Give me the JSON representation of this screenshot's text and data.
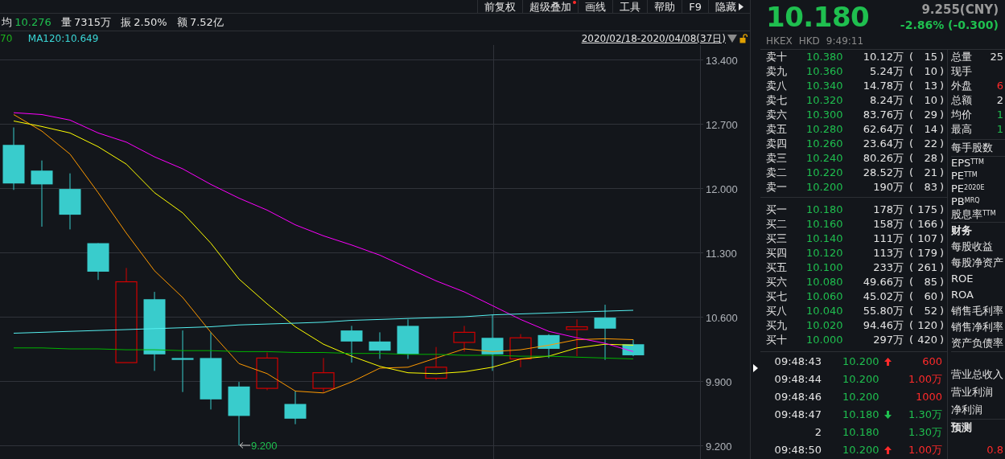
{
  "toolbar": [
    {
      "label": "前复权",
      "dot": false,
      "menu": false
    },
    {
      "label": "超级叠加",
      "dot": true,
      "menu": false
    },
    {
      "label": "画线",
      "dot": false,
      "menu": false
    },
    {
      "label": "工具",
      "dot": false,
      "menu": false
    },
    {
      "label": "帮助",
      "dot": false,
      "menu": false
    },
    {
      "label": "F9",
      "dot": false,
      "menu": false
    },
    {
      "label": "隐藏",
      "dot": false,
      "menu": true
    }
  ],
  "summary": [
    {
      "label": "均",
      "value": "10.276",
      "color": "#1fbf4f"
    },
    {
      "label": "量",
      "value": "7315万",
      "color": "#e4e4e4"
    },
    {
      "label": "振",
      "value": "2.50%",
      "color": "#e4e4e4"
    },
    {
      "label": "额",
      "value": "7.52亿",
      "color": "#e4e4e4"
    }
  ],
  "indicators": [
    {
      "text": "70",
      "color": "#1db31d"
    },
    {
      "text": "MA120:10.649",
      "color": "#3ad6d6"
    }
  ],
  "date_range": "2020/02/18-2020/04/08(37日)",
  "chart": {
    "chart_data": {
      "type": "line",
      "grid": true,
      "ylim": [
        9.051,
        13.557
      ],
      "yticks": [
        {
          "value": 13.4,
          "label": "13.400"
        },
        {
          "value": 12.7,
          "label": "12.700"
        },
        {
          "value": 12.0,
          "label": "12.000"
        },
        {
          "value": 11.3,
          "label": "11.300"
        },
        {
          "value": 10.6,
          "label": "10.600"
        },
        {
          "value": 9.9,
          "label": "9.900"
        },
        {
          "value": 9.2,
          "label": "9.200"
        }
      ],
      "series": [
        {
          "color": "#ff9900",
          "values": [
            12.8,
            12.62,
            12.37,
            11.95,
            11.51,
            11.1,
            10.81,
            10.43,
            10.09,
            9.98,
            9.79,
            9.77,
            9.89,
            10.04,
            10.05,
            10.15,
            10.25,
            10.22,
            10.24,
            10.29,
            10.35,
            10.36,
            10.35
          ]
        },
        {
          "color": "#ffff00",
          "values": [
            12.73,
            12.67,
            12.6,
            12.45,
            12.26,
            11.95,
            11.73,
            11.4,
            11.01,
            10.74,
            10.49,
            10.3,
            10.17,
            10.06,
            9.99,
            9.98,
            10.0,
            10.05,
            10.14,
            10.17,
            10.26,
            10.3,
            10.29
          ]
        },
        {
          "color": "#ff00ff",
          "values": [
            12.82,
            12.8,
            12.74,
            12.6,
            12.5,
            12.34,
            12.21,
            12.04,
            11.89,
            11.76,
            11.6,
            11.48,
            11.38,
            11.27,
            11.13,
            10.99,
            10.87,
            10.72,
            10.57,
            10.44,
            10.37,
            10.31,
            10.22
          ]
        },
        {
          "color": "#55f0f0",
          "values": [
            10.42,
            10.43,
            10.44,
            10.45,
            10.46,
            10.47,
            10.48,
            10.49,
            10.51,
            10.52,
            10.53,
            10.54,
            10.56,
            10.57,
            10.58,
            10.59,
            10.6,
            10.62,
            10.63,
            10.64,
            10.65,
            10.66,
            10.67
          ]
        },
        {
          "color": "#00b400",
          "values": [
            10.26,
            10.26,
            10.25,
            10.25,
            10.24,
            10.24,
            10.23,
            10.23,
            10.22,
            10.22,
            10.21,
            10.21,
            10.2,
            10.2,
            10.19,
            10.19,
            10.18,
            10.18,
            10.17,
            10.17,
            10.16,
            10.15,
            10.14
          ]
        }
      ],
      "annotations": [
        {
          "text": "9.200"
        }
      ]
    }
  },
  "quote": {
    "price": "10.180",
    "price_cny": "9.255(CNY)",
    "change": "-2.86% (-0.300)",
    "color": "#1fbf4f",
    "exchange": "HKEX",
    "currency": "HKD",
    "time": "9:49:11"
  },
  "asks": [
    {
      "label": "卖十",
      "price": "10.380",
      "volume": "10.12万",
      "open": "(",
      "count": "15",
      "close": ")"
    },
    {
      "label": "卖九",
      "price": "10.360",
      "volume": "5.24万",
      "open": "(",
      "count": "10",
      "close": ")"
    },
    {
      "label": "卖八",
      "price": "10.340",
      "volume": "14.78万",
      "open": "(",
      "count": "13",
      "close": ")"
    },
    {
      "label": "卖七",
      "price": "10.320",
      "volume": "8.24万",
      "open": "(",
      "count": "10",
      "close": ")"
    },
    {
      "label": "卖六",
      "price": "10.300",
      "volume": "83.76万",
      "open": "(",
      "count": "29",
      "close": ")"
    },
    {
      "label": "卖五",
      "price": "10.280",
      "volume": "62.64万",
      "open": "(",
      "count": "14",
      "close": ")"
    },
    {
      "label": "卖四",
      "price": "10.260",
      "volume": "23.64万",
      "open": "(",
      "count": "22",
      "close": ")"
    },
    {
      "label": "卖三",
      "price": "10.240",
      "volume": "80.26万",
      "open": "(",
      "count": "28",
      "close": ")"
    },
    {
      "label": "卖二",
      "price": "10.220",
      "volume": "28.52万",
      "open": "(",
      "count": "21",
      "close": ")"
    },
    {
      "label": "卖一",
      "price": "10.200",
      "volume": "190万",
      "open": "(",
      "count": "83",
      "close": ")"
    }
  ],
  "bids": [
    {
      "label": "买一",
      "price": "10.180",
      "volume": "178万",
      "open": "(",
      "count": "175",
      "close": ")"
    },
    {
      "label": "买二",
      "price": "10.160",
      "volume": "158万",
      "open": "(",
      "count": "166",
      "close": ")"
    },
    {
      "label": "买三",
      "price": "10.140",
      "volume": "111万",
      "open": "(",
      "count": "107",
      "close": ")"
    },
    {
      "label": "买四",
      "price": "10.120",
      "volume": "113万",
      "open": "(",
      "count": "179",
      "close": ")"
    },
    {
      "label": "买五",
      "price": "10.100",
      "volume": "233万",
      "open": "(",
      "count": "261",
      "close": ")"
    },
    {
      "label": "买六",
      "price": "10.080",
      "volume": "49.66万",
      "open": "(",
      "count": "85",
      "close": ")"
    },
    {
      "label": "买七",
      "price": "10.060",
      "volume": "45.02万",
      "open": "(",
      "count": "60",
      "close": ")"
    },
    {
      "label": "买八",
      "price": "10.040",
      "volume": "55.80万",
      "open": "(",
      "count": "52",
      "close": ")"
    },
    {
      "label": "买九",
      "price": "10.020",
      "volume": "94.46万",
      "open": "(",
      "count": "120",
      "close": ")"
    },
    {
      "label": "买十",
      "price": "10.000",
      "volume": "297万",
      "open": "(",
      "count": "420",
      "close": ")"
    }
  ],
  "trades": [
    {
      "time": "09:48:43",
      "price": "10.200",
      "kind": "up",
      "volume": "600",
      "color": "#ff2a2a"
    },
    {
      "time": "09:48:44",
      "price": "10.200",
      "kind": "plain",
      "volume": "1.00万",
      "color": "#ff2a2a"
    },
    {
      "time": "09:48:46",
      "price": "10.200",
      "kind": "plain",
      "volume": "1000",
      "color": "#ff2a2a"
    },
    {
      "time": "09:48:47",
      "price": "10.180",
      "kind": "down",
      "volume": "1.30万",
      "color": "#1fbf4f"
    },
    {
      "time": "2",
      "price": "10.180",
      "kind": "plain",
      "volume": "1.30万",
      "color": "#1fbf4f"
    },
    {
      "time": "09:48:50",
      "price": "10.200",
      "kind": "up",
      "volume": "1.00万",
      "color": "#ff2a2a"
    }
  ],
  "stats": [
    {
      "label": "总量",
      "value": "25",
      "color": "#e4e4e4"
    },
    {
      "label": "现手"
    },
    {
      "label": "外盘",
      "value": "6",
      "color": "#ff2a2a"
    },
    {
      "label": "总额",
      "value": "2",
      "color": "#e4e4e4"
    },
    {
      "label": "均价",
      "value": "1",
      "color": "#1fbf4f"
    },
    {
      "label": "最高",
      "value": "1",
      "color": "#1fbf4f"
    }
  ],
  "lot_size": "每手股数",
  "valuation": [
    "EPS$^{TTM}$",
    "PE$^{TTM}$",
    "PE$^{2020E}$",
    "PB$^{MRQ}$",
    "股息率$^{TTM}$"
  ],
  "finance": {
    "title": "财务",
    "items": [
      "每股收益",
      "每股净资产",
      "ROE",
      "ROA",
      "销售毛利率",
      "销售净利率",
      "资产负债率"
    ]
  },
  "income": [
    "营业总收入",
    "营业利润",
    "净利润"
  ],
  "forecast": {
    "title": "预测",
    "value": "0.8"
  }
}
